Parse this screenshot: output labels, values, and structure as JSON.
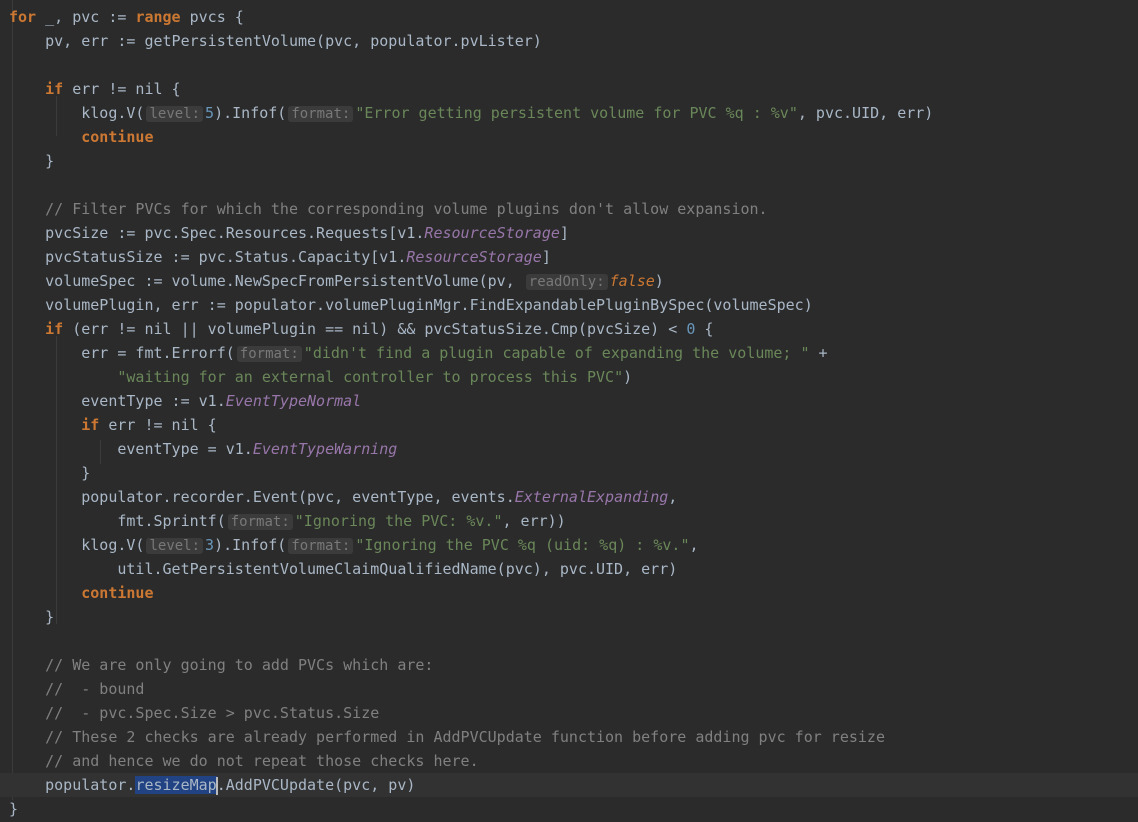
{
  "lines": [
    [
      {
        "t": "for",
        "c": "kw"
      },
      {
        "t": " _, pvc := "
      },
      {
        "t": "range",
        "c": "kw"
      },
      {
        "t": " pvcs {"
      }
    ],
    [
      {
        "t": "    pv, err := getPersistentVolume(pvc, populator.pvLister)"
      }
    ],
    [],
    [
      {
        "t": "    "
      },
      {
        "t": "if",
        "c": "kw"
      },
      {
        "t": " err != nil {"
      }
    ],
    [
      {
        "t": "        klog.V("
      },
      {
        "t": "level:",
        "c": "hint"
      },
      {
        "t": "5",
        "c": "num"
      },
      {
        "t": ").Infof("
      },
      {
        "t": "format:",
        "c": "hint"
      },
      {
        "t": "\"Error getting persistent volume for PVC %q : %v\"",
        "c": "str"
      },
      {
        "t": ", pvc.UID, err)"
      }
    ],
    [
      {
        "t": "        "
      },
      {
        "t": "continue",
        "c": "kw"
      }
    ],
    [
      {
        "t": "    }"
      }
    ],
    [],
    [
      {
        "t": "    // Filter PVCs for which the corresponding volume plugins don't allow expansion.",
        "c": "cm"
      }
    ],
    [
      {
        "t": "    pvcSize := pvc.Spec.Resources.Requests[v1."
      },
      {
        "t": "ResourceStorage",
        "c": "it"
      },
      {
        "t": "]"
      }
    ],
    [
      {
        "t": "    pvcStatusSize := pvc.Status.Capacity[v1."
      },
      {
        "t": "ResourceStorage",
        "c": "it"
      },
      {
        "t": "]"
      }
    ],
    [
      {
        "t": "    volumeSpec := volume.NewSpecFromPersistentVolume(pv, "
      },
      {
        "t": "readOnly:",
        "c": "hint"
      },
      {
        "t": "false",
        "c": "ital"
      },
      {
        "t": ")"
      }
    ],
    [
      {
        "t": "    volumePlugin, err := populator.volumePluginMgr.FindExpandablePluginBySpec(volumeSpec)"
      }
    ],
    [
      {
        "t": "    "
      },
      {
        "t": "if",
        "c": "kw"
      },
      {
        "t": " (err != nil || volumePlugin == nil) && pvcStatusSize.Cmp(pvcSize) < "
      },
      {
        "t": "0",
        "c": "num"
      },
      {
        "t": " {"
      }
    ],
    [
      {
        "t": "        err = fmt.Errorf("
      },
      {
        "t": "format:",
        "c": "hint"
      },
      {
        "t": "\"didn't find a plugin capable of expanding the volume; \"",
        "c": "str"
      },
      {
        "t": " +"
      }
    ],
    [
      {
        "t": "            "
      },
      {
        "t": "\"waiting for an external controller to process this PVC\"",
        "c": "str"
      },
      {
        "t": ")"
      }
    ],
    [
      {
        "t": "        eventType := v1."
      },
      {
        "t": "EventTypeNormal",
        "c": "it"
      }
    ],
    [
      {
        "t": "        "
      },
      {
        "t": "if",
        "c": "kw"
      },
      {
        "t": " err != nil {"
      }
    ],
    [
      {
        "t": "            eventType = v1."
      },
      {
        "t": "EventTypeWarning",
        "c": "it"
      }
    ],
    [
      {
        "t": "        }"
      }
    ],
    [
      {
        "t": "        populator.recorder.Event(pvc, eventType, events."
      },
      {
        "t": "ExternalExpanding",
        "c": "it"
      },
      {
        "t": ","
      }
    ],
    [
      {
        "t": "            fmt.Sprintf("
      },
      {
        "t": "format:",
        "c": "hint"
      },
      {
        "t": "\"Ignoring the PVC: %v.\"",
        "c": "str"
      },
      {
        "t": ", err))"
      }
    ],
    [
      {
        "t": "        klog.V("
      },
      {
        "t": "level:",
        "c": "hint"
      },
      {
        "t": "3",
        "c": "num"
      },
      {
        "t": ").Infof("
      },
      {
        "t": "format:",
        "c": "hint"
      },
      {
        "t": "\"Ignoring the PVC %q (uid: %q) : %v.\"",
        "c": "str"
      },
      {
        "t": ","
      }
    ],
    [
      {
        "t": "            util.GetPersistentVolumeClaimQualifiedName(pvc), pvc.UID, err)"
      }
    ],
    [
      {
        "t": "        "
      },
      {
        "t": "continue",
        "c": "kw"
      }
    ],
    [
      {
        "t": "    }"
      }
    ],
    [],
    [
      {
        "t": "    // We are only going to add PVCs which are:",
        "c": "cm"
      }
    ],
    [
      {
        "t": "    //  - bound",
        "c": "cm"
      }
    ],
    [
      {
        "t": "    //  - pvc.Spec.Size > pvc.Status.Size",
        "c": "cm"
      }
    ],
    [
      {
        "t": "    // These 2 checks are already performed in AddPVCUpdate function before adding pvc for resize",
        "c": "cm"
      }
    ],
    [
      {
        "t": "    // and hence we do not repeat those checks here.",
        "c": "cm"
      }
    ],
    [
      {
        "t": "    populator."
      },
      {
        "t": "resizeMap",
        "c": "sel"
      },
      {
        "t": "",
        "c": "caret"
      },
      {
        "t": ".AddPVCUpdate(pvc, pv)"
      }
    ],
    [
      {
        "t": "}"
      }
    ]
  ],
  "current_line": 32
}
